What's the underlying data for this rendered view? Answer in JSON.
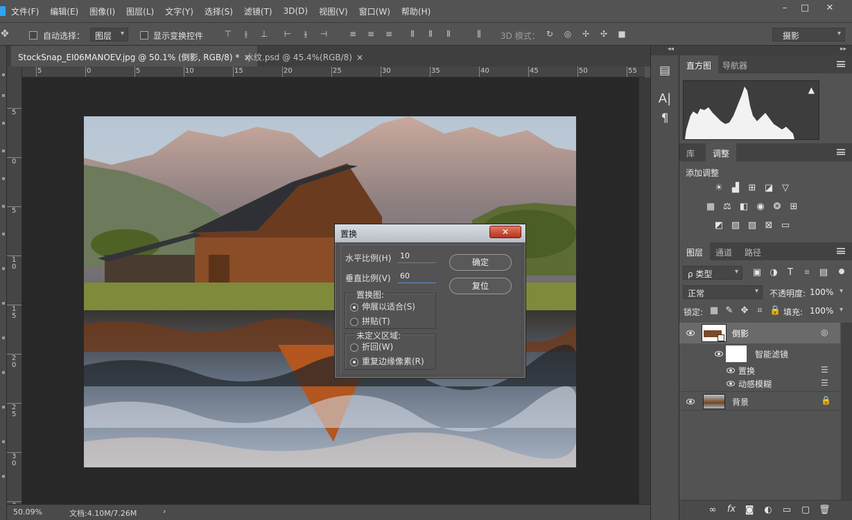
{
  "menubar": {
    "items": [
      "文件(F)",
      "编辑(E)",
      "图像(I)",
      "图层(L)",
      "文字(Y)",
      "选择(S)",
      "滤镜(T)",
      "3D(D)",
      "视图(V)",
      "窗口(W)",
      "帮助(H)"
    ],
    "window_controls": [
      "–",
      "□",
      "✕"
    ]
  },
  "options": {
    "auto_select_label": "自动选择：",
    "auto_select_value": "图层",
    "show_transform_label": "显示变换控件",
    "mode3d_label": "3D 模式：",
    "workspace_value": "摄影"
  },
  "tabs": [
    {
      "label": "StockSnap_EI06MANOEV.jpg @ 50.1% (倒影, RGB/8) *",
      "close": "×"
    },
    {
      "label": "水纹.psd @ 45.4%(RGB/8)",
      "close": "×"
    }
  ],
  "ruler": {
    "top": [
      "5",
      "0",
      "5",
      "10",
      "15",
      "20",
      "25",
      "30",
      "35",
      "40",
      "45",
      "50",
      "55"
    ],
    "left": [
      "5",
      "0",
      "5",
      "1\n0",
      "1\n5",
      "2\n0",
      "2\n5",
      "3\n0",
      "3\n5"
    ]
  },
  "status": {
    "zoom": "50.09%",
    "doc": "文档:4.10M/7.26M",
    "arrow": "›"
  },
  "dialog": {
    "title": "置换",
    "close": "✕",
    "h_scale_label": "水平比例(H)",
    "h_scale_value": "10",
    "v_scale_label": "垂直比例(V)",
    "v_scale_value": "60",
    "ok_label": "确定",
    "reset_label": "复位",
    "map_group": "置换图:",
    "stretch_label": "伸展以适合(S)",
    "tile_label": "拼贴(T)",
    "undefined_group": "未定义区域:",
    "wrap_label": "折回(W)",
    "repeat_label": "重复边缘像素(R)"
  },
  "panels": {
    "histogram_tab": "直方图",
    "navigator_tab": "导航器",
    "library_tab": "库",
    "adjust_tab": "调整",
    "add_adjust": "添加调整",
    "layers_tab": "图层",
    "channels_tab": "通道",
    "paths_tab": "路径",
    "kind_label": "ρ 类型",
    "blend_mode": "正常",
    "opacity_label": "不透明度:",
    "opacity_value": "100%",
    "lock_label": "锁定:",
    "fill_label": "填充:",
    "fill_value": "100%"
  },
  "layers": [
    {
      "name": "倒影"
    },
    {
      "name": "智能滤镜"
    },
    {
      "name": "置换"
    },
    {
      "name": "动感模糊"
    },
    {
      "name": "背景"
    }
  ],
  "colors": {
    "app_bg": "#535353",
    "canvas_bg": "#282828",
    "dialog_close": "#c0391f",
    "selected_layer": "#6a6a6a"
  }
}
